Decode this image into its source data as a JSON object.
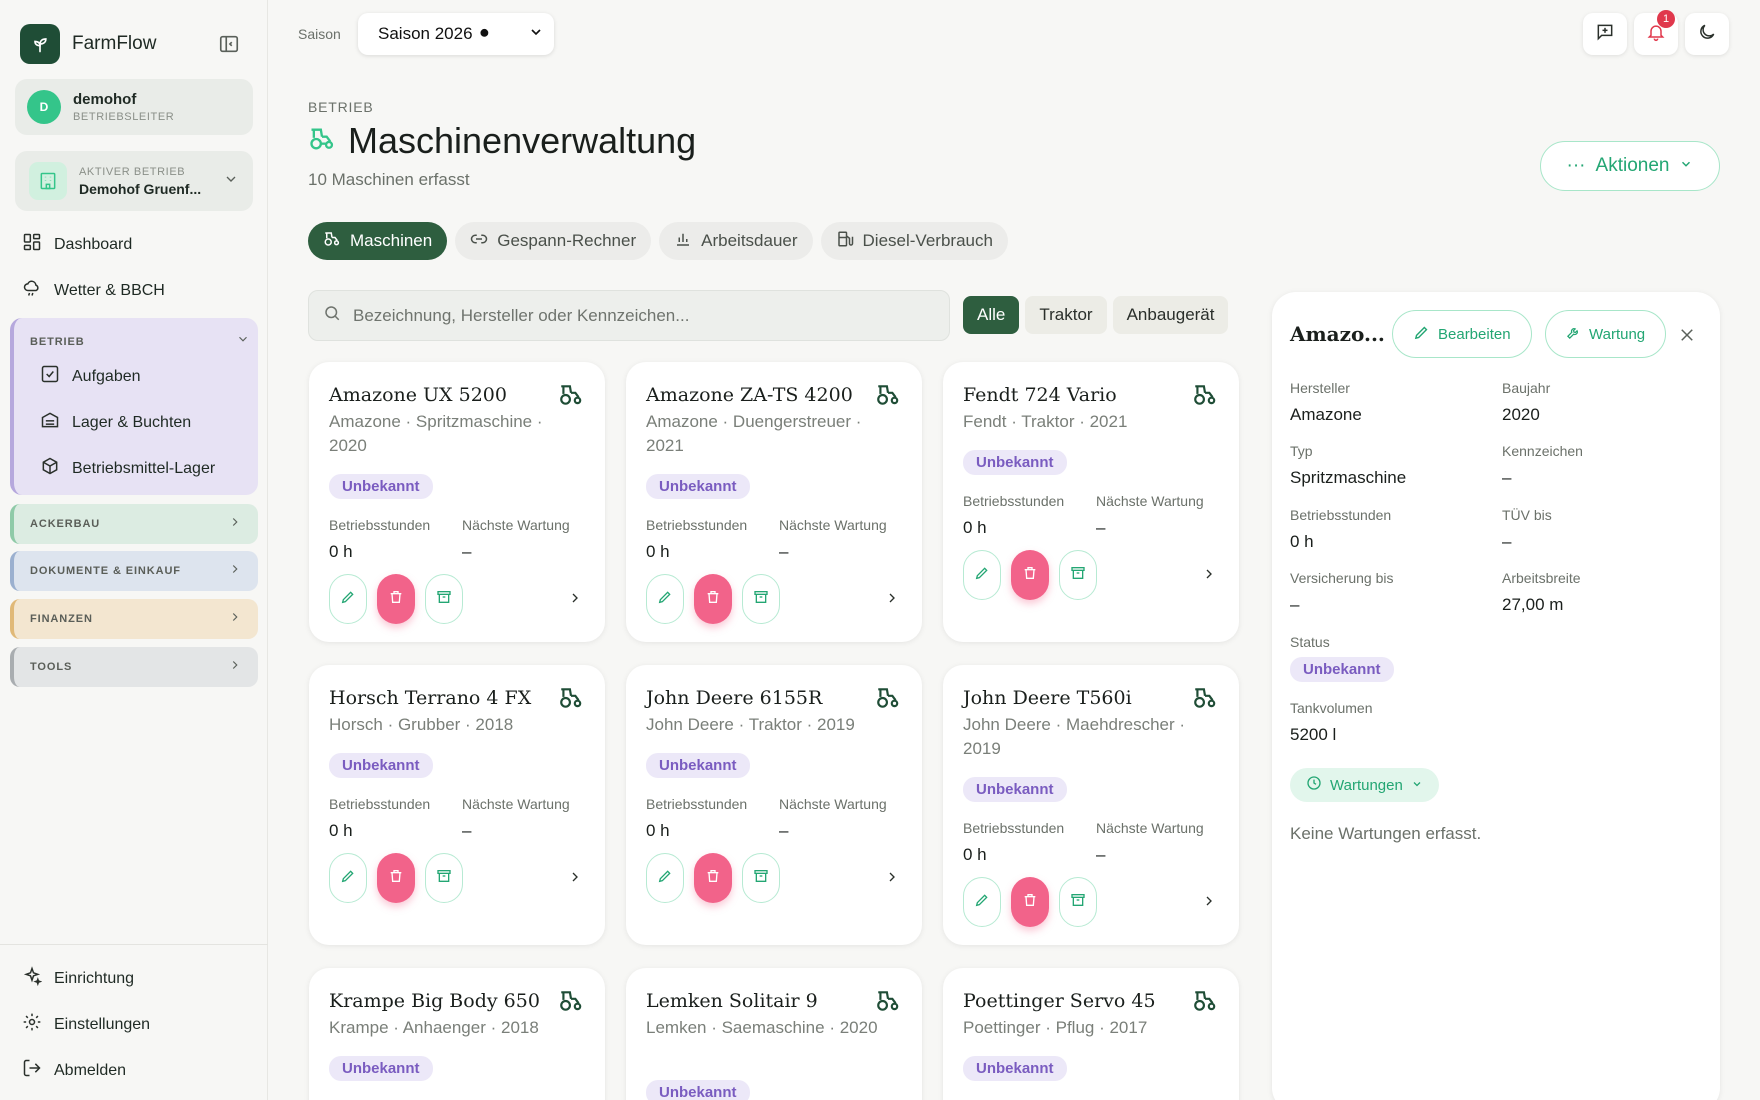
{
  "app": {
    "name": "FarmFlow"
  },
  "user": {
    "initial": "D",
    "name": "demohof",
    "role": "BETRIEBSLEITER"
  },
  "farm": {
    "label": "AKTIVER BETRIEB",
    "name": "Demohof Gruenf..."
  },
  "nav": {
    "dashboard": "Dashboard",
    "weather": "Wetter & BBCH"
  },
  "groups": {
    "betrieb": {
      "label": "BETRIEB",
      "items": [
        "Aufgaben",
        "Lager & Buchten",
        "Betriebsmittel-Lager"
      ]
    },
    "ackerbau": "ACKERBAU",
    "dokumente": "DOKUMENTE & EINKAUF",
    "finanzen": "FINANZEN",
    "tools": "TOOLS"
  },
  "footer_nav": {
    "setup": "Einrichtung",
    "settings": "Einstellungen",
    "logout": "Abmelden"
  },
  "topbar": {
    "season_label": "Saison",
    "season_value": "Saison 2026 ⚫",
    "notification_count": "1"
  },
  "header": {
    "section": "BETRIEB",
    "title": "Maschinenverwaltung",
    "subtitle": "10 Maschinen erfasst",
    "actions": "Aktionen"
  },
  "tabs": [
    "Maschinen",
    "Gespann-Rechner",
    "Arbeitsdauer",
    "Diesel-Verbrauch"
  ],
  "search": {
    "placeholder": "Bezeichnung, Hersteller oder Kennzeichen..."
  },
  "filters": [
    "Alle",
    "Traktor",
    "Anbaugerät"
  ],
  "card_labels": {
    "hours": "Betriebsstunden",
    "next_service": "Nächste Wartung"
  },
  "machines": [
    {
      "name": "Amazone UX 5200",
      "meta": "Amazone · Spritzmaschine · 2020",
      "status": "Unbekannt",
      "hours": "0 h",
      "next": "–"
    },
    {
      "name": "Amazone ZA-TS 4200",
      "meta": "Amazone · Duengerstreuer · 2021",
      "status": "Unbekannt",
      "hours": "0 h",
      "next": "–"
    },
    {
      "name": "Fendt 724 Vario",
      "meta": "Fendt · Traktor · 2021",
      "status": "Unbekannt",
      "hours": "0 h",
      "next": "–"
    },
    {
      "name": "Horsch Terrano 4 FX",
      "meta": "Horsch · Grubber · 2018",
      "status": "Unbekannt",
      "hours": "0 h",
      "next": "–"
    },
    {
      "name": "John Deere 6155R",
      "meta": "John Deere · Traktor · 2019",
      "status": "Unbekannt",
      "hours": "0 h",
      "next": "–"
    },
    {
      "name": "John Deere T560i",
      "meta": "John Deere · Maehdrescher · 2019",
      "status": "Unbekannt",
      "hours": "0 h",
      "next": "–"
    },
    {
      "name": "Krampe Big Body 650",
      "meta": "Krampe · Anhaenger · 2018",
      "status": "Unbekannt"
    },
    {
      "name": "Lemken Solitair 9",
      "meta": "Lemken · Saemaschine · 2020",
      "status": "Unbekannt"
    },
    {
      "name": "Poettinger Servo 45",
      "meta": "Poettinger · Pflug · 2017",
      "status": "Unbekannt"
    }
  ],
  "detail": {
    "title": "Amazo...",
    "edit": "Bearbeiten",
    "service": "Wartung",
    "fields": [
      {
        "label": "Hersteller",
        "value": "Amazone"
      },
      {
        "label": "Baujahr",
        "value": "2020"
      },
      {
        "label": "Typ",
        "value": "Spritzmaschine"
      },
      {
        "label": "Kennzeichen",
        "value": "–"
      },
      {
        "label": "Betriebsstunden",
        "value": "0 h"
      },
      {
        "label": "TÜV bis",
        "value": "–"
      },
      {
        "label": "Versicherung bis",
        "value": "–"
      },
      {
        "label": "Arbeitsbreite",
        "value": "27,00 m"
      }
    ],
    "status_label": "Status",
    "status_value": "Unbekannt",
    "tank_label": "Tankvolumen",
    "tank_value": "5200 l",
    "services_toggle": "Wartungen",
    "services_empty": "Keine Wartungen erfasst."
  },
  "colors": {
    "brand": "#1f4d36",
    "accent": "#23a673",
    "tab_active": "#2e5e3f",
    "delete": "#f2638a",
    "badge_text": "#7a5cc0"
  }
}
